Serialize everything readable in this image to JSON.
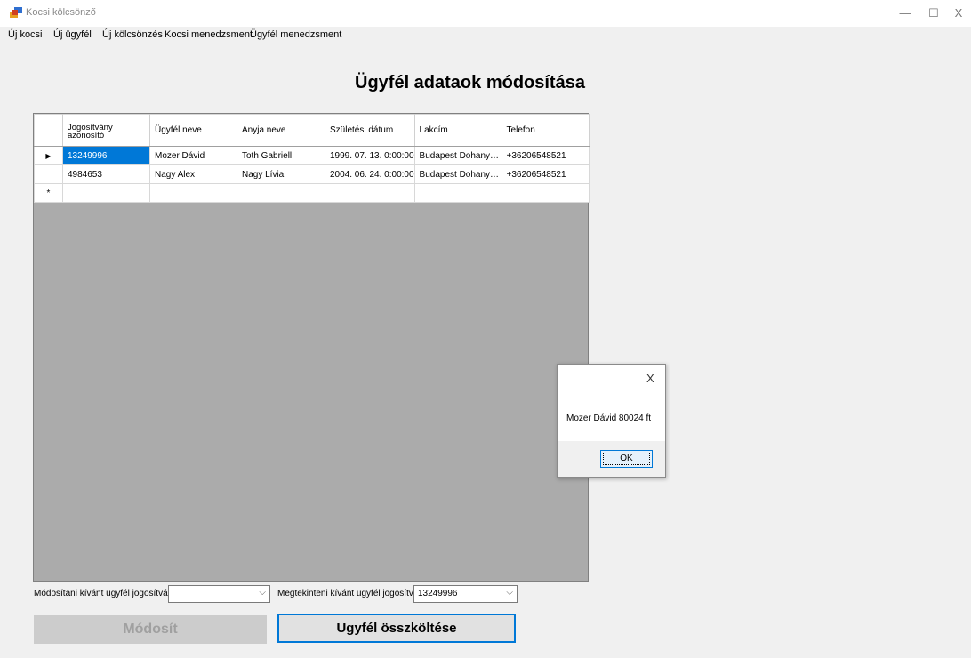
{
  "window": {
    "title": "Kocsi kölcsönző",
    "controls": {
      "minimize": "—",
      "maximize": "☐",
      "close": "X"
    }
  },
  "menu": {
    "items": [
      "Új kocsi",
      "Új ügyfél",
      "Új kölcsönzés",
      "Kocsi menedzsment",
      "Ügyfél menedzsment"
    ]
  },
  "page": {
    "title": "Ügyfél adataok módosítása"
  },
  "grid": {
    "columns": [
      "Jogosítvány azonosító",
      "Ügyfél neve",
      "Anyja neve",
      "Születési dátum",
      "Lakcím",
      "Telefon"
    ],
    "rows": [
      [
        "13249996",
        "Mozer Dávid",
        "Toth Gabriell",
        "1999. 07. 13. 0:00:00",
        "Budapest Dohany utca...",
        "+36206548521"
      ],
      [
        "4984653",
        "Nagy Alex",
        "Nagy Lívia",
        "2004. 06. 24. 0:00:00",
        "Budapest Dohany utca...",
        "+36206548521"
      ]
    ],
    "current_row_marker": "▶",
    "new_row_marker": "*"
  },
  "dialog": {
    "close": "X",
    "message": "Mozer Dávid 80024 ft",
    "ok_label": "OK"
  },
  "controls": {
    "modify_label": "Módosítani kívánt ügyfél jogosítványa:",
    "modify_value": "",
    "view_label": "Megtekinteni kívánt ügyfél jogosítványa:",
    "view_value": "13249996",
    "modify_button": "Módosít",
    "total_button": "Ugyfél összköltése"
  },
  "colors": {
    "selection": "#0078d7",
    "grid_background": "#ababab",
    "accent_border": "#0078d7"
  }
}
